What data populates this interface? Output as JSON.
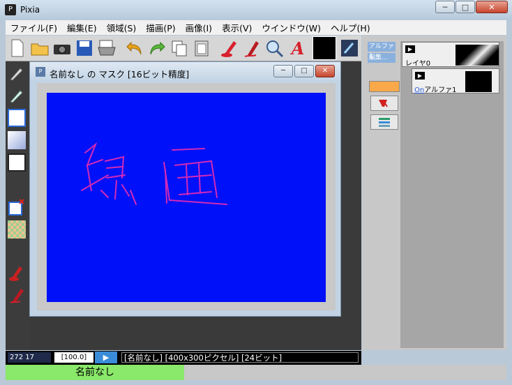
{
  "window": {
    "title": "Pixia",
    "app_icon": "pixia-app-icon",
    "minimize": "─",
    "maximize": "□",
    "close": "✕"
  },
  "menu": [
    "ファイル(F)",
    "編集(E)",
    "領域(S)",
    "描画(P)",
    "画像(I)",
    "表示(V)",
    "ウインドウ(W)",
    "ヘルプ(H)"
  ],
  "toolbar": {
    "icons": [
      "new-file-icon",
      "open-folder-icon",
      "camera-icon",
      "save-icon",
      "print-icon",
      "undo-icon",
      "redo-icon",
      "copy-icon",
      "paste-icon",
      "pen-fill-icon",
      "pen-icon",
      "zoom-icon",
      "text-icon",
      "color-swatch-icon",
      "color-picker-icon"
    ],
    "text_glyph": "A",
    "current_color": "#000000"
  },
  "left_tools": [
    "brush-icon",
    "pen-icon",
    "rectangle-icon",
    "gradient-icon",
    "selection-rect-icon",
    "clear-selection-icon",
    "pattern-icon",
    "fill-bucket-icon",
    "eraser-pen-icon"
  ],
  "document": {
    "title": "名前なし の マスク [16ビット精度]",
    "icon_label": "P",
    "canvas_color": "#0010f8",
    "stroke_color": "#d22ab8",
    "drawn_text": "線画",
    "minimize": "─",
    "maximize": "□",
    "close": "✕"
  },
  "right_panel": {
    "tabs": [
      "アルファ1",
      "編集..."
    ],
    "swatch_color": "#f9a84a",
    "layers": [
      {
        "name": "レイヤ0",
        "toggle": "▶"
      },
      {
        "name": "アルファ1",
        "prefix": "On",
        "toggle": "▶"
      }
    ]
  },
  "status": {
    "coords": "272 17",
    "zoom": "[100.0]",
    "play": "▶",
    "info": "[名前なし] [400x300ピクセル] [24ビット]"
  },
  "task": {
    "tab_label": "名前なし"
  }
}
